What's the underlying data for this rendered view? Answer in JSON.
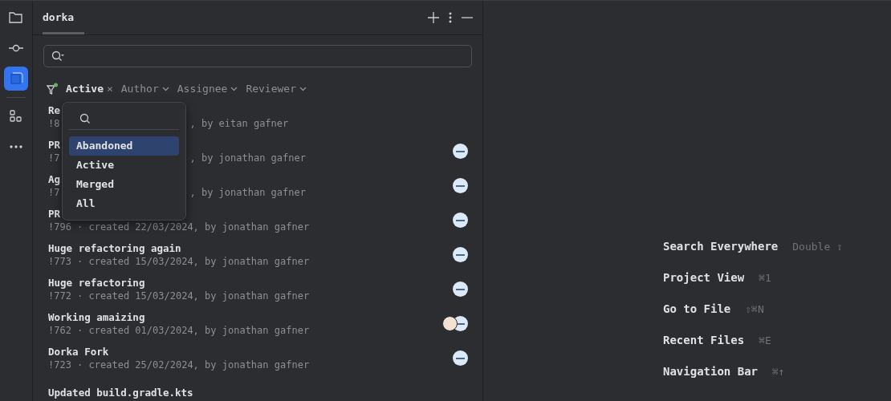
{
  "sidebar": {
    "items": [
      {
        "kind": "folder",
        "selected": false
      },
      {
        "kind": "commit",
        "selected": false
      },
      {
        "kind": "pull-requests",
        "selected": true
      },
      {
        "kind": "structure",
        "selected": false
      },
      {
        "kind": "more",
        "selected": false
      }
    ]
  },
  "panel": {
    "tabs": [
      {
        "label": "dorka",
        "selected": true
      }
    ],
    "filters": [
      {
        "kind": "value",
        "label": "Active",
        "x": "×"
      },
      {
        "kind": "dropdown",
        "label": "Author"
      },
      {
        "kind": "dropdown",
        "label": "Assignee"
      },
      {
        "kind": "dropdown",
        "label": "Reviewer"
      }
    ],
    "rows": [
      {
        "title": "Re",
        "meta_start": "!8",
        "meta_end": ", by eitan gafner"
      },
      {
        "title": "PR",
        "meta_start": "!7",
        "meta_end": ", by jonathan gafner",
        "avatars": [
          {
            "kind": "logo"
          }
        ]
      },
      {
        "title": "Ag",
        "meta_start": "!7",
        "meta_end": ", by jonathan gafner",
        "avatars": [
          {
            "kind": "logo"
          }
        ]
      },
      {
        "title": "PR",
        "meta": "!796 · created 22/03/2024, by jonathan gafner",
        "avatars": [
          {
            "kind": "logo"
          }
        ]
      },
      {
        "title": "Huge refactoring again",
        "meta": "!773 · created 15/03/2024, by jonathan gafner",
        "avatars": [
          {
            "kind": "logo"
          }
        ]
      },
      {
        "title": "Huge refactoring",
        "meta": "!772 · created 15/03/2024, by jonathan gafner",
        "avatars": [
          {
            "kind": "logo"
          }
        ]
      },
      {
        "title": "Working amaizing",
        "meta": "!762 · created 01/03/2024, by jonathan gafner",
        "avatars": [
          {
            "kind": "person"
          },
          {
            "kind": "logo"
          }
        ]
      },
      {
        "title": "Dorka Fork",
        "meta": "!723 · created 25/02/2024, by jonathan gafner",
        "avatars": [
          {
            "kind": "logo"
          }
        ]
      },
      {
        "title": "Updated build.gradle.kts"
      }
    ],
    "dropdown": {
      "items": [
        {
          "label": "Abandoned",
          "selected": true
        },
        {
          "label": "Active",
          "selected": false
        },
        {
          "label": "Merged",
          "selected": false
        },
        {
          "label": "All",
          "selected": false
        }
      ]
    }
  },
  "hints": [
    {
      "action": "Search Everywhere",
      "shortcut": "Double ⇧"
    },
    {
      "action": "Project View",
      "shortcut": "⌘1"
    },
    {
      "action": "Go to File",
      "shortcut": "⇧⌘N"
    },
    {
      "action": "Recent Files",
      "shortcut": "⌘E"
    },
    {
      "action": "Navigation Bar",
      "shortcut": "⌘↑"
    }
  ]
}
